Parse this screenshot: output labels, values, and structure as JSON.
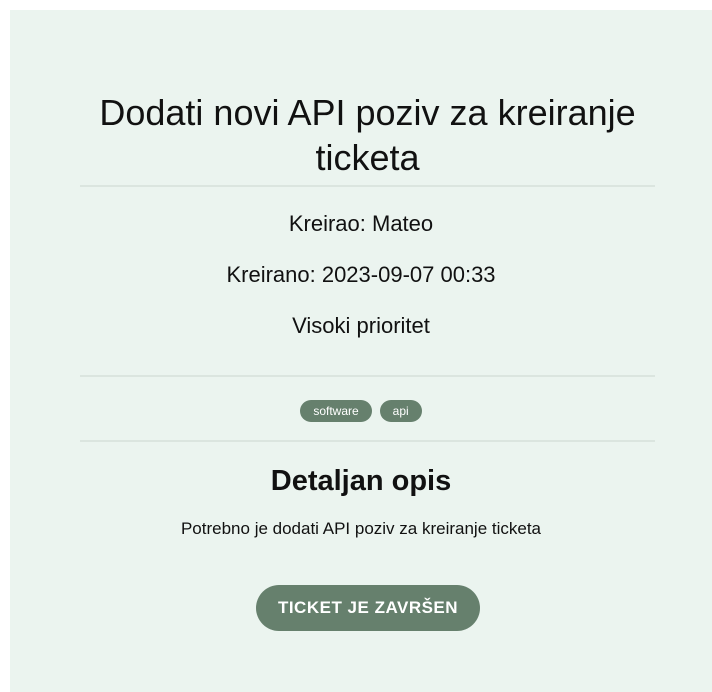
{
  "ticket": {
    "title": "Dodati novi API poziv za kreiranje ticketa",
    "created_by": "Kreirao: Mateo",
    "created_at": "Kreirano: 2023-09-07 00:33",
    "priority": "Visoki prioritet",
    "tags": [
      "software",
      "api"
    ],
    "details_heading": "Detaljan opis",
    "description": "Potrebno je dodati API poziv za kreiranje ticketa",
    "complete_button_label": "TICKET JE ZAVRŠEN"
  },
  "colors": {
    "card_background": "#ebf4ef",
    "accent": "#66806d",
    "divider": "#dbe5df"
  }
}
